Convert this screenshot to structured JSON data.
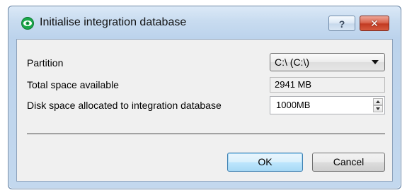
{
  "window": {
    "title": "Initialise integration database",
    "help_glyph": "?",
    "close_glyph": "✕",
    "icon": "eye-icon"
  },
  "form": {
    "partition_label": "Partition",
    "partition_value": "C:\\ (C:\\)",
    "total_space_label": "Total space available",
    "total_space_value": "2941 MB",
    "allocated_label": "Disk space allocated to integration database",
    "allocated_value": "1000MB"
  },
  "buttons": {
    "ok": "OK",
    "cancel": "Cancel"
  },
  "colors": {
    "title_gradient": "#c9dcf0",
    "close_button": "#c23a22",
    "ok_button": "#bee6fd",
    "icon_green": "#1aa84a"
  }
}
